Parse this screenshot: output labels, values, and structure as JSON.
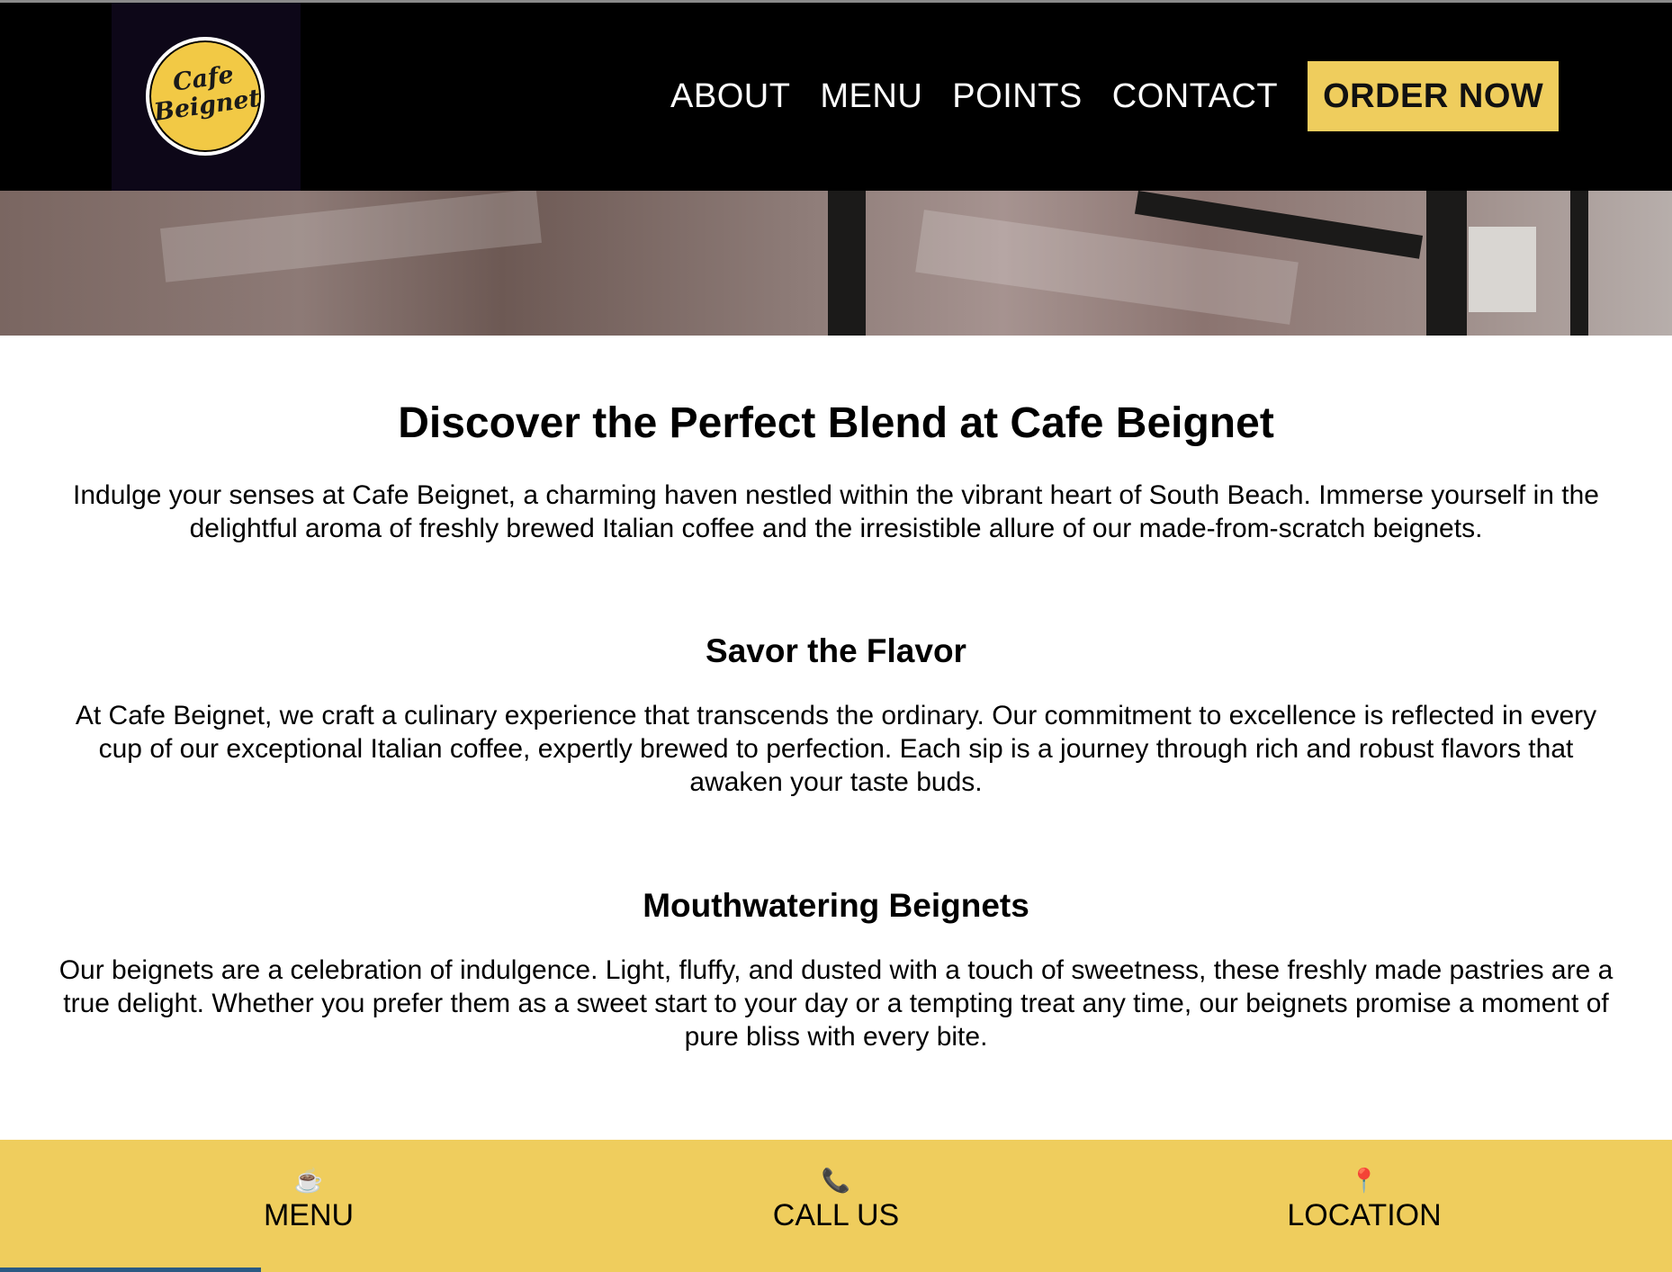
{
  "header": {
    "logo": {
      "line1": "Cafe",
      "line2": "Beignet"
    },
    "nav": [
      "ABOUT",
      "MENU",
      "POINTS",
      "CONTACT"
    ],
    "cta_label": "ORDER NOW",
    "colors": {
      "background": "#000000",
      "accent": "#efcd5d"
    }
  },
  "main": {
    "title": "Discover the Perfect Blend at Cafe Beignet",
    "intro": "Indulge your senses at Cafe Beignet, a charming haven nestled within the vibrant heart of South Beach. Immerse yourself in the delightful aroma of freshly brewed Italian coffee and the irresistible allure of our made-from-scratch beignets.",
    "sections": [
      {
        "heading": "Savor the Flavor",
        "body": "At Cafe Beignet, we craft a culinary experience that transcends the ordinary. Our commitment to excellence is reflected in every cup of our exceptional Italian coffee, expertly brewed to perfection. Each sip is a journey through rich and robust flavors that awaken your taste buds."
      },
      {
        "heading": "Mouthwatering Beignets",
        "body": "Our beignets are a celebration of indulgence. Light, fluffy, and dusted with a touch of sweetness, these freshly made pastries are a true delight. Whether you prefer them as a sweet start to your day or a tempting treat any time, our beignets promise a moment of pure bliss with every bite."
      }
    ]
  },
  "bottom_bar": {
    "items": [
      {
        "icon": "coffee-cup-icon",
        "glyph": "☕",
        "label": "MENU"
      },
      {
        "icon": "phone-icon",
        "glyph": "📞",
        "label": "CALL US"
      },
      {
        "icon": "map-pin-icon",
        "glyph": "📍",
        "label": "LOCATION"
      }
    ],
    "colors": {
      "background": "#efcd5d"
    }
  }
}
